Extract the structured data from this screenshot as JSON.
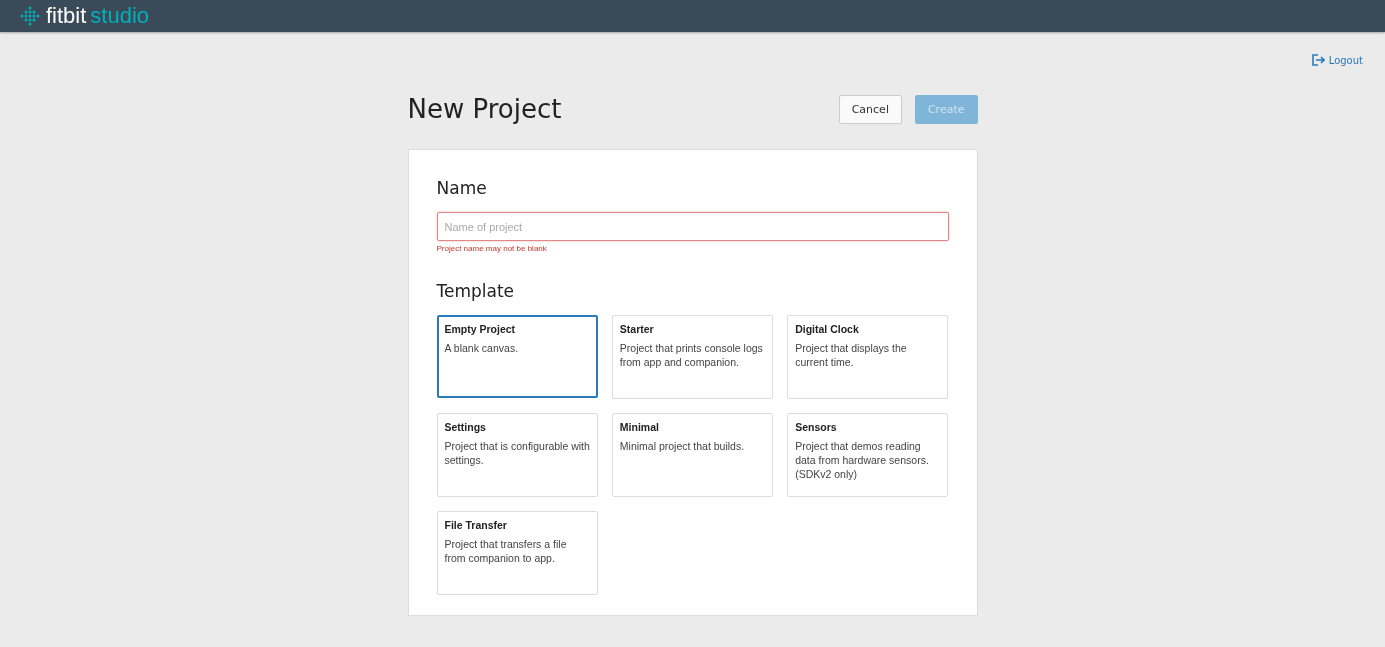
{
  "header": {
    "logo_word": "fitbit",
    "logo_product": "studio"
  },
  "logout": "Logout",
  "page": {
    "title": "New Project",
    "buttons": [
      {
        "label": "Cancel",
        "kind": "secondary",
        "disabled": false
      },
      {
        "label": "Create",
        "kind": "primary",
        "disabled": true
      }
    ]
  },
  "name_section": {
    "heading": "Name",
    "placeholder": "Name of project",
    "error": "Project name may not be blank"
  },
  "template_section": {
    "heading": "Template",
    "templates": [
      {
        "title": "Empty Project",
        "description": "A blank canvas.",
        "selected": true
      },
      {
        "title": "Starter",
        "description": "Project that prints console logs from app and companion.",
        "selected": false
      },
      {
        "title": "Digital Clock",
        "description": "Project that displays the current time.",
        "selected": false
      },
      {
        "title": "Settings",
        "description": "Project that is configurable with settings.",
        "selected": false
      },
      {
        "title": "Minimal",
        "description": "Minimal project that builds.",
        "selected": false
      },
      {
        "title": "Sensors",
        "description": "Project that demos reading data from hardware sensors. (SDKv2 only)",
        "selected": false
      },
      {
        "title": "File Transfer",
        "description": "Project that transfers a file from companion to app.",
        "selected": false
      }
    ]
  }
}
